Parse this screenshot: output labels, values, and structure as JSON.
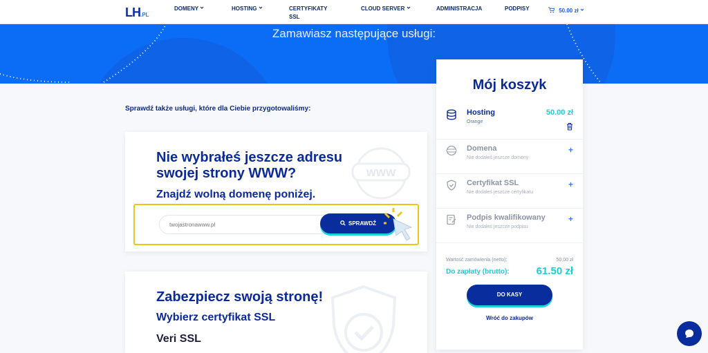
{
  "header": {
    "logo_main": "LH",
    "logo_suffix": ".PL",
    "nav": [
      "DOMENY",
      "HOSTING",
      "CERTYFIKATY SSL",
      "CLOUD SERVER",
      "ADMINISTRACJA",
      "PODPISY"
    ],
    "cart_total": "50.00 zł"
  },
  "hero": {
    "title": "Zamawiasz następujące usługi:"
  },
  "left": {
    "intro": "Sprawdź także usługi, które dla Ciebie przygotowaliśmy:",
    "domain_card": {
      "heading": "Nie wybrałeś jeszcze adresu swojej strony WWW?",
      "subheading": "Znajdź wolną domenę poniżej.",
      "input_placeholder": "twojastronawww.pl",
      "button": "SPRAWDŹ",
      "watermark_text": "WWW"
    },
    "ssl_card": {
      "heading": "Zabezpiecz swoją stronę!",
      "subheading": "Wybierz certyfikat SSL",
      "product": "Veri SSL"
    }
  },
  "cart": {
    "title": "Mój koszyk",
    "items": [
      {
        "name": "Hosting",
        "sub": "Orange",
        "price": "50.00 zł"
      },
      {
        "name": "Domena",
        "sub": "Nie dodałeś jeszcze domeny"
      },
      {
        "name": "Certyfikat SSL",
        "sub": "Nie dodałeś jeszcze certyfikatu"
      },
      {
        "name": "Podpis kwalifikowany",
        "sub": "Nie dodałeś jeszcze podpisu"
      }
    ],
    "net_label": "Wartość zamówienia (netto):",
    "net_value": "50.00 zł",
    "gross_label": "Do zapłaty (brutto):",
    "gross_value": "61.50 zł",
    "checkout": "DO KASY",
    "back": "Wróć do zakupów"
  },
  "colors": {
    "brand": "#0a2d9e",
    "accent": "#17d6d8",
    "hero": "#0b6cf6",
    "highlight": "#f0c419"
  }
}
